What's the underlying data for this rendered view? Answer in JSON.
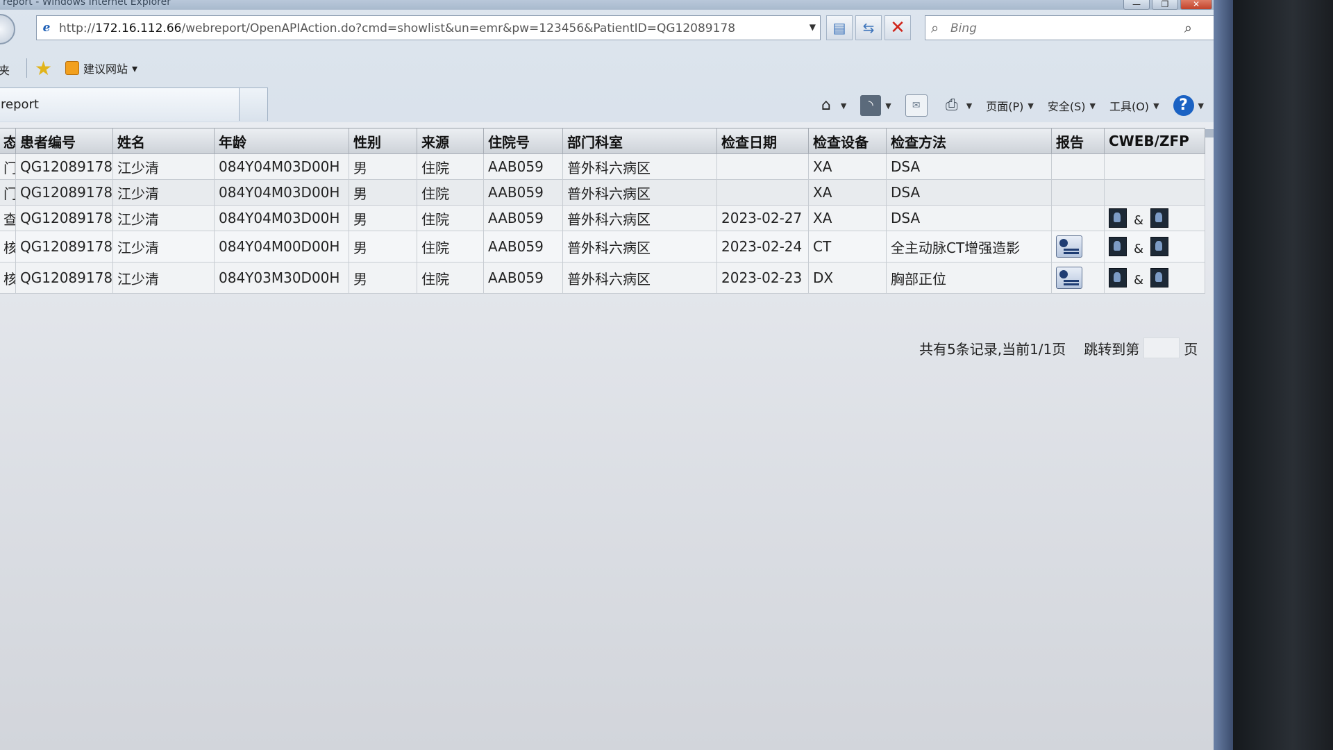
{
  "window": {
    "title": "report - Windows Internet Explorer",
    "minimize_glyph": "—",
    "restore_glyph": "❐",
    "close_glyph": "✕"
  },
  "navbar": {
    "address_prefix": "http://",
    "address_host": "172.16.112.66",
    "address_rest": "/webreport/OpenAPIAction.do?cmd=showlist&un=emr&pw=123456&PatientID=QG12089178",
    "search_placeholder": "Bing",
    "icons": [
      "ie-logo-icon",
      "compatibility-view-icon",
      "refresh-icon",
      "stop-icon",
      "search-icon"
    ]
  },
  "favorites_bar": {
    "left_label": "夹",
    "suggested_sites_label": "建议网站"
  },
  "tab": {
    "label": "report"
  },
  "command_bar": {
    "page_label": "页面(P)",
    "safety_label": "安全(S)",
    "tools_label": "工具(O)",
    "icons": [
      "home-icon",
      "rss-feed-icon",
      "read-mail-icon",
      "print-icon",
      "help-icon"
    ]
  },
  "table": {
    "columns": [
      "态",
      "患者编号",
      "姓名",
      "年龄",
      "性别",
      "来源",
      "住院号",
      "部门科室",
      "检查日期",
      "检查设备",
      "检查方法",
      "报告",
      "CWEB/ZFP"
    ],
    "rows": [
      {
        "status": "门",
        "patient_id": "QG12089178",
        "name": "江少清",
        "age": "084Y04M03D00H",
        "sex": "男",
        "source": "住院",
        "inpatient_no": "AAB059",
        "department": "普外科六病区",
        "exam_date": "",
        "device": "XA",
        "method": "DSA",
        "has_report": false,
        "has_images": false
      },
      {
        "status": "门",
        "patient_id": "QG12089178",
        "name": "江少清",
        "age": "084Y04M03D00H",
        "sex": "男",
        "source": "住院",
        "inpatient_no": "AAB059",
        "department": "普外科六病区",
        "exam_date": "",
        "device": "XA",
        "method": "DSA",
        "has_report": false,
        "has_images": false
      },
      {
        "status": "查",
        "patient_id": "QG12089178",
        "name": "江少清",
        "age": "084Y04M03D00H",
        "sex": "男",
        "source": "住院",
        "inpatient_no": "AAB059",
        "department": "普外科六病区",
        "exam_date": "2023-02-27",
        "device": "XA",
        "method": "DSA",
        "has_report": false,
        "has_images": true
      },
      {
        "status": "核",
        "patient_id": "QG12089178",
        "name": "江少清",
        "age": "084Y04M00D00H",
        "sex": "男",
        "source": "住院",
        "inpatient_no": "AAB059",
        "department": "普外科六病区",
        "exam_date": "2023-02-24",
        "device": "CT",
        "method": "全主动脉CT增强造影",
        "has_report": true,
        "has_images": true
      },
      {
        "status": "核",
        "patient_id": "QG12089178",
        "name": "江少清",
        "age": "084Y03M30D00H",
        "sex": "男",
        "source": "住院",
        "inpatient_no": "AAB059",
        "department": "普外科六病区",
        "exam_date": "2023-02-23",
        "device": "DX",
        "method": "胸部正位",
        "has_report": true,
        "has_images": true
      }
    ],
    "image_separator": "&"
  },
  "pager": {
    "summary": "共有5条记录,当前1/1页",
    "jump_label": "跳转到第",
    "page_suffix": "页",
    "page_input_value": ""
  }
}
